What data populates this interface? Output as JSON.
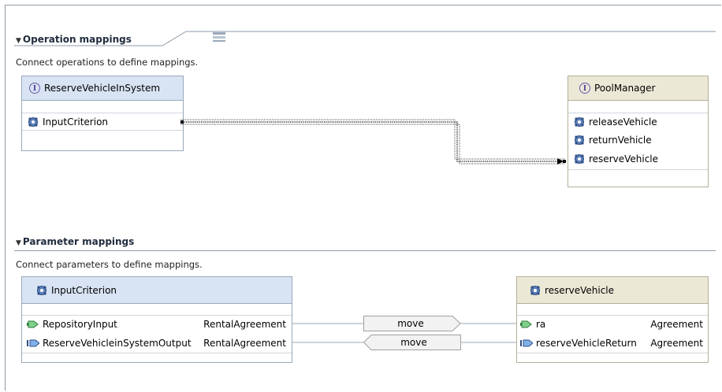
{
  "operation_section": {
    "title": "Operation mappings",
    "description": "Connect operations to define mappings.",
    "source": {
      "title": "ReserveVehicleInSystem",
      "items": [
        "InputCriterion"
      ]
    },
    "target": {
      "title": "PoolManager",
      "items": [
        "releaseVehicle",
        "returnVehicle",
        "reserveVehicle"
      ]
    }
  },
  "parameter_section": {
    "title": "Parameter mappings",
    "description": "Connect parameters to define mappings.",
    "source": {
      "title": "InputCriterion",
      "rows": [
        {
          "name": "RepositoryInput",
          "type": "RentalAgreement"
        },
        {
          "name": "ReserveVehicleinSystemOutput",
          "type": "RentalAgreement"
        }
      ]
    },
    "target": {
      "title": "reserveVehicle",
      "rows": [
        {
          "name": "ra",
          "type": "Agreement"
        },
        {
          "name": "reserveVehicleReturn",
          "type": "Agreement"
        }
      ]
    },
    "transforms": [
      {
        "label": "move"
      },
      {
        "label": "move"
      }
    ]
  },
  "icons": {
    "interface": "interface-icon",
    "operation": "gear-icon",
    "input": "input-pin-icon",
    "output": "output-pin-icon"
  },
  "colors": {
    "source_header": "#d8e4f3",
    "target_header": "#ebe8d6",
    "line": "#9aa8ba"
  }
}
